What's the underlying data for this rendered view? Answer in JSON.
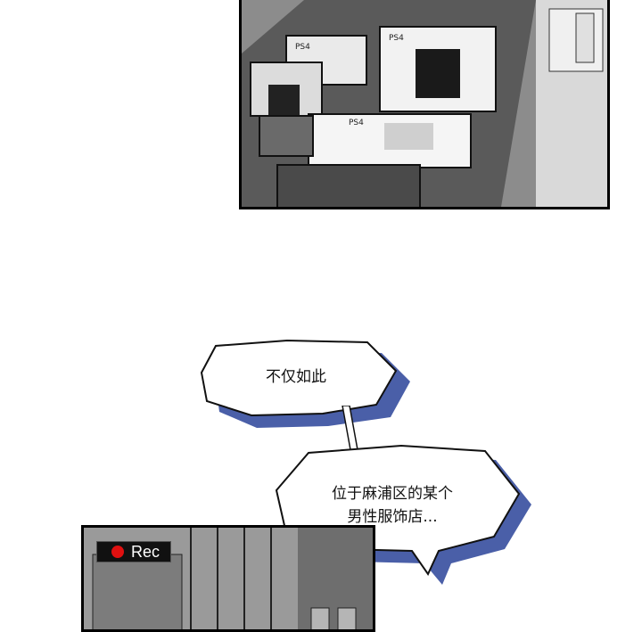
{
  "bubbles": [
    {
      "text": "不仅如此"
    },
    {
      "line1": "位于麻浦区的某个",
      "line2": "男性服饰店..."
    }
  ],
  "rec_indicator": {
    "label": "Rec",
    "dot_color": "#e01010"
  },
  "colors": {
    "bubble_shadow": "#4a5fa8",
    "ink": "#111111"
  }
}
